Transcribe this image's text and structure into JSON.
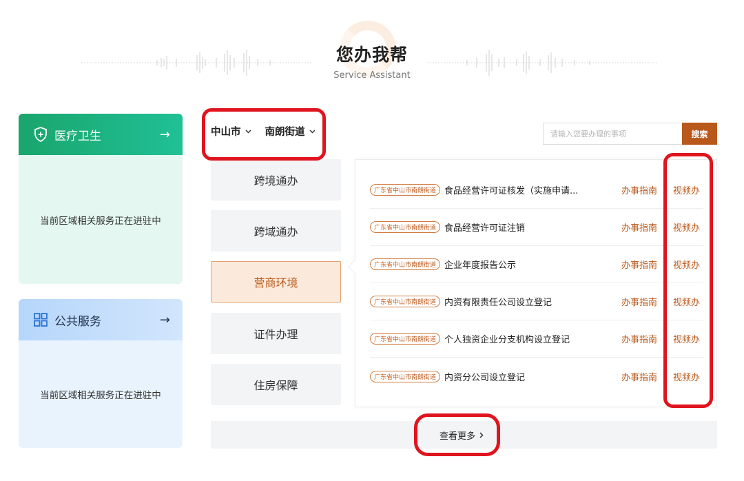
{
  "header": {
    "title": "您办我帮",
    "subtitle": "Service Assistant"
  },
  "cards": [
    {
      "label": "医疗卫生",
      "icon": "shield-plus-icon",
      "message": "当前区域相关服务正在进驻中",
      "color": "#1aa56c"
    },
    {
      "label": "公共服务",
      "icon": "grid-icon",
      "message": "当前区域相关服务正在进驻中",
      "color": "#b6d6fb"
    }
  ],
  "location": {
    "city": "中山市",
    "street": "南朗街道"
  },
  "search": {
    "placeholder": "请输入您要办理的事项",
    "button_label": "搜索"
  },
  "tabs": [
    {
      "label": "跨境通办",
      "active": false
    },
    {
      "label": "跨域通办",
      "active": false
    },
    {
      "label": "营商环境",
      "active": true
    },
    {
      "label": "证件办理",
      "active": false
    },
    {
      "label": "住房保障",
      "active": false
    }
  ],
  "items": [
    {
      "tag": "广东省中山市南朗街道",
      "title": "食品经营许可证核发（实施申请...",
      "guide": "办事指南",
      "video": "视频办"
    },
    {
      "tag": "广东省中山市南朗街道",
      "title": "食品经营许可证注销",
      "guide": "办事指南",
      "video": "视频办"
    },
    {
      "tag": "广东省中山市南朗街道",
      "title": "企业年度报告公示",
      "guide": "办事指南",
      "video": "视频办"
    },
    {
      "tag": "广东省中山市南朗街道",
      "title": "内资有限责任公司设立登记",
      "guide": "办事指南",
      "video": "视频办"
    },
    {
      "tag": "广东省中山市南朗街道",
      "title": "个人独资企业分支机构设立登记",
      "guide": "办事指南",
      "video": "视频办"
    },
    {
      "tag": "广东省中山市南朗街道",
      "title": "内资分公司设立登记",
      "guide": "办事指南",
      "video": "视频办"
    }
  ],
  "more_label": "查看更多",
  "colors": {
    "accent": "#b8581a",
    "annotation": "#e0141e"
  }
}
